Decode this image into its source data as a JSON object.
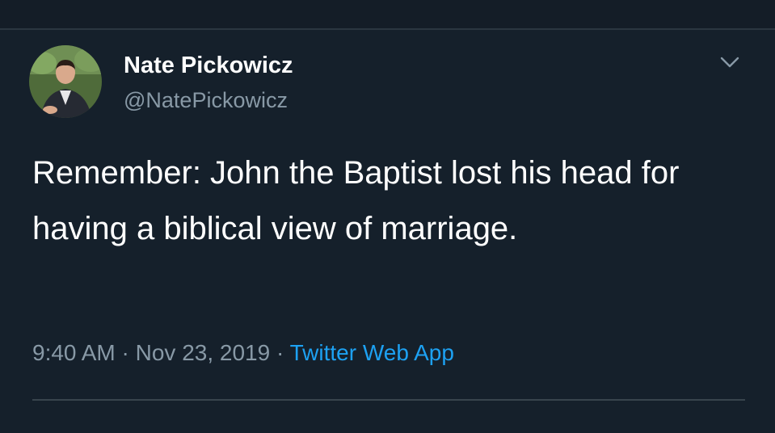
{
  "tweet": {
    "author": {
      "display_name": "Nate Pickowicz",
      "handle": "@NatePickowicz"
    },
    "text": "Remember: John the Baptist lost his head for having a biblical view of marriage.",
    "time": "9:40 AM",
    "separator": " · ",
    "date": "Nov 23, 2019",
    "source": "Twitter Web App"
  },
  "icons": {
    "avatar": "author-avatar",
    "menu": "chevron-down-icon"
  },
  "colors": {
    "background": "#15202b",
    "text_primary": "#ffffff",
    "text_secondary": "#8899a6",
    "link": "#1da1f2",
    "divider": "#38444d"
  }
}
